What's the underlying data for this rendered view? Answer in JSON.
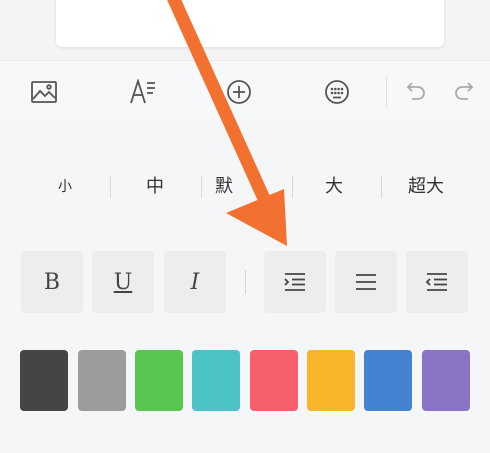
{
  "editor": {
    "doc_snippet": ""
  },
  "toolbar": {
    "items": [
      {
        "icon": "image-icon"
      },
      {
        "icon": "text-style-icon"
      },
      {
        "icon": "add-circle-icon"
      },
      {
        "icon": "emoji-icon"
      },
      {
        "icon": "undo-icon"
      },
      {
        "icon": "redo-icon"
      }
    ]
  },
  "font_sizes": {
    "options": [
      "小",
      "中",
      "默",
      "大",
      "超大"
    ]
  },
  "format": {
    "bold_label": "B",
    "underline_label": "U",
    "italic_label": "I"
  },
  "colors": [
    "#454545",
    "#9c9c9c",
    "#5bc552",
    "#4cc3c6",
    "#f7606a",
    "#f6b52a",
    "#4482d2",
    "#8a72c5"
  ],
  "annotation": {
    "arrow_color": "#f27131"
  }
}
